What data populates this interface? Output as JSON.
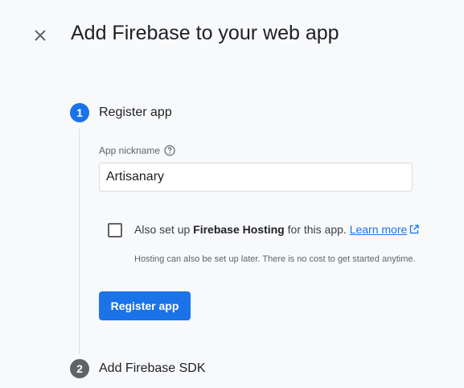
{
  "header": {
    "title": "Add Firebase to your web app",
    "close_icon": "close-icon"
  },
  "steps": [
    {
      "number": "1",
      "title": "Register app",
      "state": "active"
    },
    {
      "number": "2",
      "title": "Add Firebase SDK",
      "state": "pending"
    }
  ],
  "register": {
    "nickname_label": "App nickname",
    "help_icon": "help-circle-icon",
    "nickname_value": "Artisanary",
    "hosting_prefix": "Also set up ",
    "hosting_bold": "Firebase Hosting",
    "hosting_suffix": " for this app.",
    "learn_more": "Learn more",
    "external_icon": "external-link-icon",
    "hosting_checked": false,
    "hosting_note": "Hosting can also be set up later. There is no cost to get started anytime.",
    "button_label": "Register app"
  },
  "colors": {
    "accent": "#1a73e8",
    "pending_step": "#5f6368",
    "background": "#f8f9fa"
  }
}
